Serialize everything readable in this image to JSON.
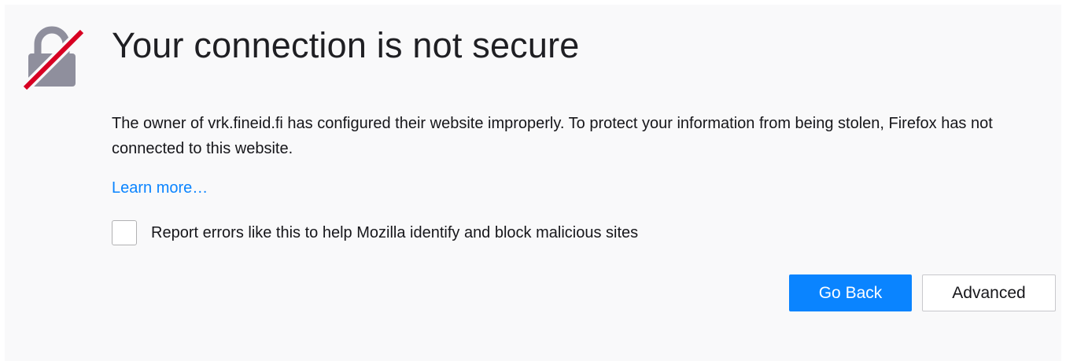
{
  "page": {
    "title": "Your connection is not secure",
    "description": "The owner of vrk.fineid.fi has configured their website improperly. To protect your information from being stolen, Firefox has not connected to this website.",
    "learn_more": "Learn more…",
    "report_label": "Report errors like this to help Mozilla identify and block malicious sites"
  },
  "buttons": {
    "go_back": "Go Back",
    "advanced": "Advanced"
  },
  "icons": {
    "lock": "broken-lock-icon"
  },
  "colors": {
    "accent": "#0a84ff",
    "warning_slash": "#d70022",
    "lock_gray": "#8f8f9d",
    "background": "#f9f9fa"
  }
}
